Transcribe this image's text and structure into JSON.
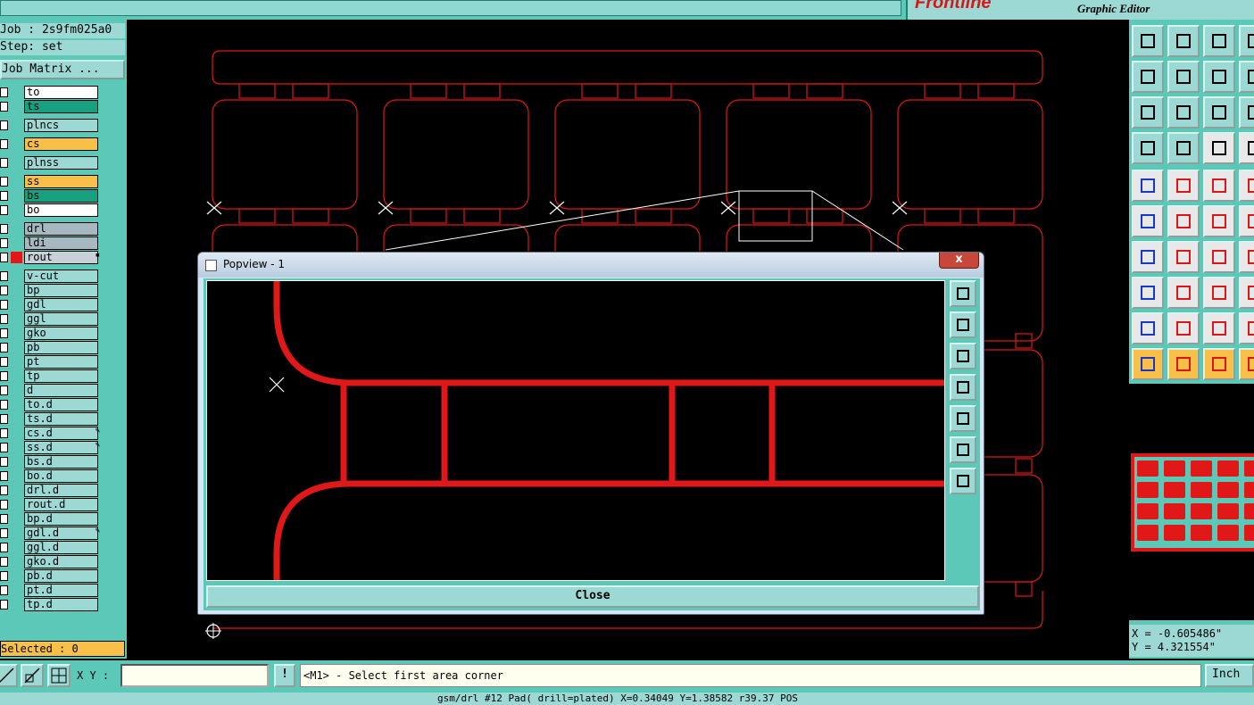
{
  "app": {
    "brand_partial": "Frontline",
    "subtitle": "Graphic Editor"
  },
  "left": {
    "job": "Job : 2s9fm025a0",
    "step": "Step: set",
    "job_matrix_button": "Job Matrix ...",
    "selected": "Selected : 0",
    "layers": [
      {
        "name": "to",
        "bg": "#ffffff"
      },
      {
        "name": "ts",
        "bg": "#18a080"
      },
      {
        "name": "plncs",
        "bg": "#9cd8d4"
      },
      {
        "name": "cs",
        "bg": "#f8c048"
      },
      {
        "name": "plnss",
        "bg": "#9cd8d4"
      },
      {
        "name": "ss",
        "bg": "#f8c048"
      },
      {
        "name": "bs",
        "bg": "#18a080"
      },
      {
        "name": "bo",
        "bg": "#ffffff"
      },
      {
        "name": "drl",
        "bg": "#a8b8c0"
      },
      {
        "name": "ldi",
        "bg": "#a8b8c0"
      },
      {
        "name": "rout",
        "bg": "#c8d0d8"
      },
      {
        "name": "v-cut",
        "bg": "#9cd8d4"
      },
      {
        "name": "bp",
        "bg": "#9cd8d4"
      },
      {
        "name": "gdl",
        "bg": "#9cd8d4"
      },
      {
        "name": "ggl",
        "bg": "#9cd8d4"
      },
      {
        "name": "gko",
        "bg": "#9cd8d4"
      },
      {
        "name": "pb",
        "bg": "#9cd8d4"
      },
      {
        "name": "pt",
        "bg": "#9cd8d4"
      },
      {
        "name": "tp",
        "bg": "#9cd8d4"
      },
      {
        "name": "d",
        "bg": "#9cd8d4"
      },
      {
        "name": "to.d",
        "bg": "#9cd8d4"
      },
      {
        "name": "ts.d",
        "bg": "#9cd8d4"
      },
      {
        "name": "cs.d",
        "bg": "#9cd8d4"
      },
      {
        "name": "ss.d",
        "bg": "#9cd8d4"
      },
      {
        "name": "bs.d",
        "bg": "#9cd8d4"
      },
      {
        "name": "bo.d",
        "bg": "#9cd8d4"
      },
      {
        "name": "drl.d",
        "bg": "#9cd8d4"
      },
      {
        "name": "rout.d",
        "bg": "#9cd8d4"
      },
      {
        "name": "bp.d",
        "bg": "#9cd8d4"
      },
      {
        "name": "gdl.d",
        "bg": "#9cd8d4"
      },
      {
        "name": "ggl.d",
        "bg": "#9cd8d4"
      },
      {
        "name": "gko.d",
        "bg": "#9cd8d4"
      },
      {
        "name": "pb.d",
        "bg": "#9cd8d4"
      },
      {
        "name": "pt.d",
        "bg": "#9cd8d4"
      },
      {
        "name": "tp.d",
        "bg": "#9cd8d4"
      }
    ]
  },
  "popview": {
    "title": "Popview - 1",
    "close_x": "x",
    "close_button": "Close"
  },
  "right": {
    "x": "X = -0.605486\"",
    "y": "Y = 4.321554\""
  },
  "bottom": {
    "xy_label": "X Y :",
    "xy_value": "",
    "bang": "!",
    "prompt": "<M1> - Select first area corner",
    "unit": "Inch",
    "status": "gsm/drl #12 Pad( drill=plated) X=0.34049 Y=1.38582 r39.37 POS"
  },
  "colors": {
    "panel": "#5cc8b8",
    "light": "#9cd8d4",
    "profile": "#e01818",
    "highlight": "#f8c048"
  }
}
